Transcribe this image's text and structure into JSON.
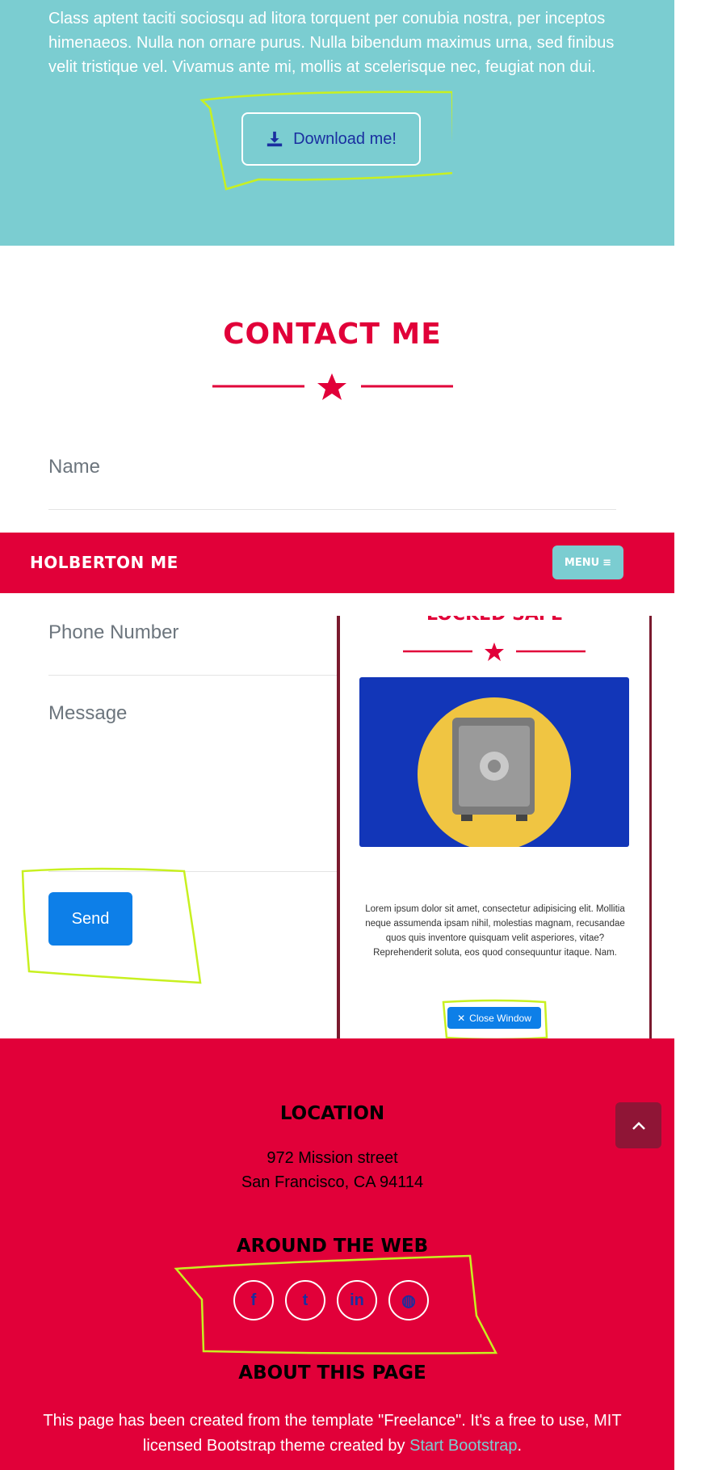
{
  "about": {
    "text": "Class aptent taciti sociosqu ad litora torquent per conubia nostra, per inceptos himenaeos. Nulla non ornare purus. Nulla bibendum maximus urna, sed finibus velit tristique vel. Vivamus ante mi, mollis at scelerisque nec, feugiat non dui.",
    "download_label": "Download me!"
  },
  "contact": {
    "title": "CONTACT ME",
    "fields": {
      "name": "Name",
      "phone": "Phone Number",
      "message": "Message"
    },
    "send_label": "Send"
  },
  "navbar": {
    "brand": "HOLBERTON ME",
    "menu_label": "MENU"
  },
  "modal": {
    "title": "LOCKED SAFE",
    "text": "Lorem ipsum dolor sit amet, consectetur adipisicing elit. Mollitia neque assumenda ipsam nihil, molestias magnam, recusandae quos quis inventore quisquam velit asperiores, vitae? Reprehenderit soluta, eos quod consequuntur itaque. Nam.",
    "close_label": "Close Window"
  },
  "footer": {
    "location_heading": "LOCATION",
    "address_line1": "972 Mission street",
    "address_line2": "San Francisco, CA 94114",
    "web_heading": "AROUND THE WEB",
    "social": [
      {
        "icon": "facebook-icon",
        "glyph": "f"
      },
      {
        "icon": "twitter-icon",
        "glyph": "t"
      },
      {
        "icon": "linkedin-icon",
        "glyph": "in"
      },
      {
        "icon": "dribbble-icon",
        "glyph": "d"
      }
    ],
    "about_heading": "ABOUT THIS PAGE",
    "about_text_before": "This page has been created from the template \"Freelance\". It's a free to use, MIT licensed Bootstrap theme created by ",
    "about_link": "Start Bootstrap",
    "about_text_after": "."
  },
  "colors": {
    "teal": "#7bcdd1",
    "brand_red": "#e10039",
    "button_blue": "#0d7fe8",
    "annotation": "#c8f020"
  }
}
